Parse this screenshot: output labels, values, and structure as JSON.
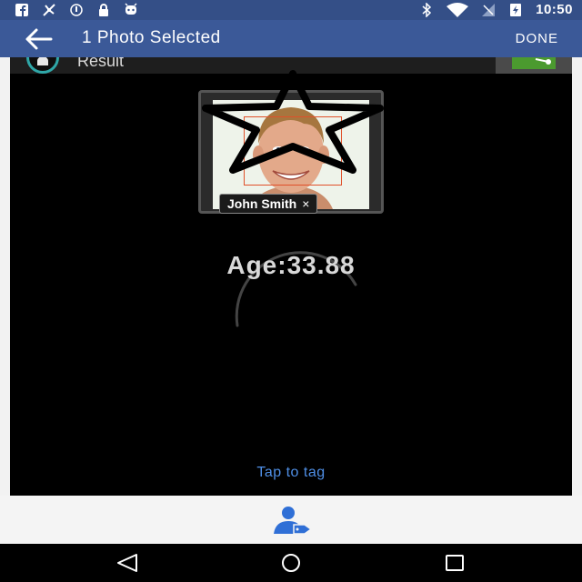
{
  "status_bar": {
    "time": "10:50",
    "left_icons": [
      "facebook-icon",
      "fan-icon",
      "sync-icon",
      "lock-icon",
      "android-icon"
    ],
    "right_icons": [
      "bluetooth-icon",
      "wifi-icon",
      "signal-icon",
      "battery-icon"
    ]
  },
  "toolbar": {
    "title": "1 Photo Selected",
    "done_label": "DONE",
    "back_icon": "arrow-left-icon"
  },
  "result": {
    "label": "Result",
    "share_icon": "share-icon"
  },
  "photo": {
    "tag_name": "John Smith",
    "tag_close": "×"
  },
  "analysis": {
    "age_text": "Age:33.88"
  },
  "tap_to_tag": "Tap to tag",
  "bottom": {
    "tag_icon": "tag-person-icon"
  },
  "navigation": {
    "icons": [
      "back-triangle-icon",
      "home-circle-icon",
      "recents-square-icon"
    ]
  },
  "colors": {
    "status_bar": "#344f87",
    "toolbar": "#3b5998",
    "link": "#4f8fe6",
    "face_box": "#e0502a"
  }
}
